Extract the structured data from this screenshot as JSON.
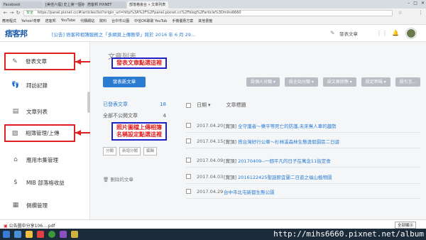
{
  "browser": {
    "tabs": [
      "Facebook",
      "[美佳六福] 史上第一個好…",
      "痞客邦 PIXNET",
      "部落格後台 » 文章列表"
    ],
    "url_secure_label": "安全",
    "url": "https://panel.pixnet.cc/#/articles/list?origin_url=http%3A%2F%2Fpanel.pixnet.cc%2Fblog%2Farticle%3Dmihs6660",
    "bookmarks": [
      "應用程式",
      "Yahoo!奇摩",
      "痞客邦",
      "YouTube",
      "代購網站",
      "飲料",
      "台中市公園",
      "中信OK歌歌 YouTub",
      "手機優惠方案",
      "其他書籤"
    ],
    "window_controls": [
      "–",
      "□",
      "✕"
    ]
  },
  "header": {
    "logo": "痞客邦",
    "announcement": "[公告] 痞客邦相簿服務之「多網頁上傳教學」將於 2016 年 6 月 29...",
    "post_button": "發表文章"
  },
  "sidebar": {
    "items": [
      {
        "label": "發表文章",
        "icon": "pencil-icon"
      },
      {
        "label": "拜訪記錄",
        "icon": "footprint-icon"
      },
      {
        "label": "文章列表",
        "icon": "document-icon"
      },
      {
        "label": "相簿管理/上傳",
        "icon": "image-icon"
      },
      {
        "label": "應用市集管理",
        "icon": "shop-icon"
      },
      {
        "label": "MIB 部落格收益",
        "icon": "money-icon"
      },
      {
        "label": "側欄管理",
        "icon": "layout-icon"
      }
    ]
  },
  "main": {
    "page_title": "文章列表",
    "new_article_button": "發表新文章",
    "filters": [
      "設個人分類 ▾",
      "設全站分類 ▾",
      "設文章狀態 ▾",
      "設定密碼 ▾",
      "設引言..."
    ],
    "left_col": {
      "published": "已發表文章",
      "published_count": "18",
      "draft": "全部不公開文章",
      "draft_count": "4",
      "buttons": [
        "分類",
        "新增分類",
        "編輯"
      ],
      "deleted": "刪除的文章"
    },
    "list_header": {
      "date": "日期",
      "sort_icon": "▾",
      "title": "文章標題"
    },
    "rows": [
      {
        "date": "2017.04.20",
        "tag": "[賞頂]",
        "title": "全守護者～樂平等死亡的防護,未來無人車的趨勢"
      },
      {
        "date": "2017.04.15",
        "tag": "[賞頂]",
        "title": "搭台灣好行公車～杉林溪森林生態渡假園區二日遊"
      },
      {
        "date": "2017.04.09",
        "tag": "[賞頂]",
        "title": "20170409--一個平凡的日子在萬念11街定食"
      },
      {
        "date": "2017.04.03",
        "tag": "[賞頂]",
        "title": "2016122425聖誕節宜蘭二日遊之福山植物園"
      },
      {
        "date": "2017.04.29",
        "tag": "",
        "title": "台中市北屯新都生態公園"
      }
    ]
  },
  "annotations": {
    "callout_post": "發表文章點選這裡",
    "callout_album": "照片圖檔上傳相簿名稱設定點選這裡"
  },
  "downloads": {
    "file": "公告圖中分享106....pdf",
    "show_all": "全部顯示"
  },
  "watermark": "http://mihs6660.pixnet.net/album",
  "colors": {
    "brand": "#1c5aa6",
    "accent": "#2a7bd2",
    "highlight": "#e02020",
    "callout_border": "#2020c8"
  }
}
